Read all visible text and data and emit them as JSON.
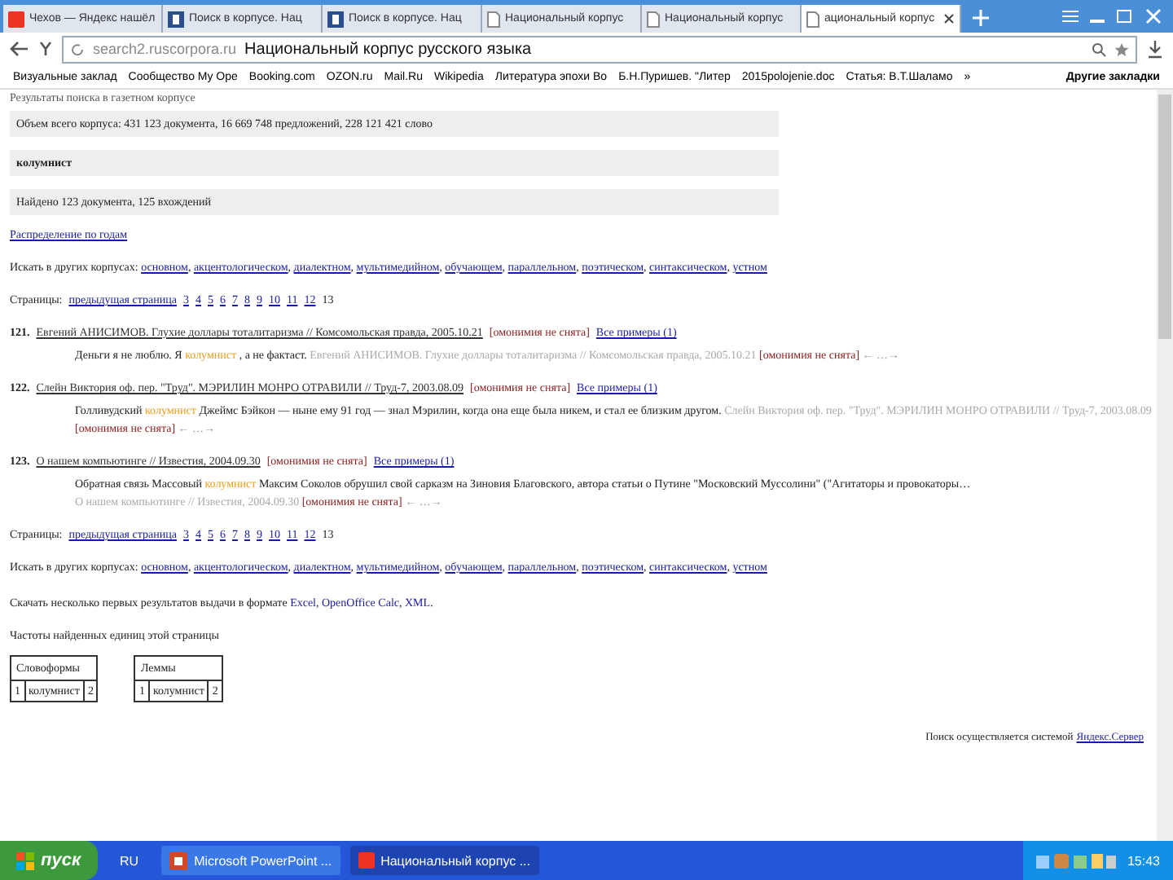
{
  "browser": {
    "tabs": [
      {
        "label": "Чехов — Яндекс нашёл",
        "selected": false
      },
      {
        "label": "Поиск в корпусе. Нац",
        "selected": false
      },
      {
        "label": "Поиск в корпусе. Нац",
        "selected": false
      },
      {
        "label": "Национальный корпус",
        "selected": false
      },
      {
        "label": "Национальный корпус",
        "selected": false
      },
      {
        "label": "ациональный корпус",
        "selected": true
      }
    ],
    "address": {
      "url": "search2.ruscorpora.ru",
      "title": "Национальный корпус русского языка"
    },
    "bookmarks": [
      "Визуальные заклад",
      "Сообщество My Ope",
      "Booking.com",
      "OZON.ru",
      "Mail.Ru",
      "Wikipedia",
      "Литература эпохи Во",
      "Б.Н.Пуришев. \"Литер",
      "2015polojenie.doc",
      "Статья: В.Т.Шаламо",
      "»"
    ],
    "other_bookmarks": "Другие закладки"
  },
  "page": {
    "heading": "Результаты поиска в газетном корпусе",
    "info_boxes": [
      {
        "text": "Объем всего корпуса: 431 123 документа, 16 669 748 предложений, 228 121 421 слово",
        "bold": false
      },
      {
        "text": "колумнист",
        "bold": true
      },
      {
        "text": "Найдено 123 документа, 125 вхождений",
        "bold": false
      }
    ],
    "distribution_link": "Распределение по годам",
    "other_corpora_top": {
      "label": "Искать в других корпусах:",
      "separator": ",",
      "links": [
        "основном",
        "акцентологическом",
        "диалектном",
        "мультимедийном",
        "обучающем",
        "параллельном",
        "поэтическом",
        "синтаксическом",
        "устном"
      ]
    },
    "pages_top": {
      "label": "Страницы:",
      "prev": "предыдущая страница",
      "pages": [
        {
          "n": "3",
          "selected": false
        },
        {
          "n": "4",
          "selected": false
        },
        {
          "n": "5",
          "selected": false
        },
        {
          "n": "6",
          "selected": false
        },
        {
          "n": "7",
          "selected": false
        },
        {
          "n": "8",
          "selected": false
        },
        {
          "n": "9",
          "selected": false
        },
        {
          "n": "10",
          "selected": false
        },
        {
          "n": "11",
          "selected": false
        },
        {
          "n": "12",
          "selected": false
        },
        {
          "n": "13",
          "selected": true
        }
      ]
    },
    "results": [
      {
        "number": "121.",
        "title": "Евгений АНИСИМОВ. Глухие доллары тоталитаризма // Комсомольская правда, 2005.10.21",
        "tag": "[омонимия не снята]",
        "all_link": "Все примеры (1)",
        "snippet": [
          {
            "kind": "text",
            "text": "Деньги я не люблю. Я"
          },
          {
            "kind": "hit",
            "text": "колумнист"
          },
          {
            "kind": "text",
            "text": ", а не фактаст."
          },
          {
            "kind": "source",
            "text": "Евгений АНИСИМОВ. Глухие доллары тоталитаризма // Комсомольская правда, 2005.10.21"
          },
          {
            "kind": "tag",
            "text": "[омонимия не снята]"
          },
          {
            "kind": "nav",
            "text": "← …→"
          }
        ]
      },
      {
        "number": "122.",
        "title": "Слейн Виктория оф. пер. \"Труд\". МЭРИЛИН МОНРО ОТРАВИЛИ // Труд-7, 2003.08.09",
        "tag": "[омонимия не снята]",
        "all_link": "Все примеры (1)",
        "snippet": [
          {
            "kind": "text",
            "text": "Голливудский"
          },
          {
            "kind": "hit",
            "text": "колумнист"
          },
          {
            "kind": "text",
            "text": "Джеймс Бэйкон — ныне ему 91 год — знал Мэрилин, когда она еще была никем, и стал ее близким другом."
          },
          {
            "kind": "source",
            "text": "Слейн Виктория оф. пер. \"Труд\". МЭРИЛИН МОНРО ОТРАВИЛИ // Труд-7, 2003.08.09"
          },
          {
            "kind": "tag",
            "text": "[омонимия не снята]"
          },
          {
            "kind": "nav",
            "text": "← …→"
          }
        ]
      },
      {
        "number": "123.",
        "title": "О нашем компьютинге // Известия, 2004.09.30",
        "tag": "[омонимия не снята]",
        "all_link": "Все примеры (1)",
        "snippet": [
          {
            "kind": "text",
            "text": "Обратная связь Массовый"
          },
          {
            "kind": "hit",
            "text": "колумнист"
          },
          {
            "kind": "text",
            "text": "Максим Соколов обрушил свой сарказм на Зиновия Благовского, автора статьи о Путине \"Московский Муссолини\" (\"Агитаторы и провокаторы…"
          },
          {
            "kind": "source",
            "text": "О нашем компьютинге // Известия, 2004.09.30"
          },
          {
            "kind": "tag",
            "text": "[омонимия не снята]"
          },
          {
            "kind": "nav",
            "text": "← …→"
          }
        ]
      }
    ],
    "pages_bottom": {
      "label": "Страницы:",
      "prev": "предыдущая страница",
      "pages": [
        {
          "n": "3",
          "selected": false
        },
        {
          "n": "4",
          "selected": false
        },
        {
          "n": "5",
          "selected": false
        },
        {
          "n": "6",
          "selected": false
        },
        {
          "n": "7",
          "selected": false
        },
        {
          "n": "8",
          "selected": false
        },
        {
          "n": "9",
          "selected": false
        },
        {
          "n": "10",
          "selected": false
        },
        {
          "n": "11",
          "selected": false
        },
        {
          "n": "12",
          "selected": false
        },
        {
          "n": "13",
          "selected": true
        }
      ]
    },
    "other_corpora_bottom": {
      "label": "Искать в других корпусах:",
      "separator": ",",
      "links": [
        "основном",
        "акцентологическом",
        "диалектном",
        "мультимедийном",
        "обучающем",
        "параллельном",
        "поэтическом",
        "синтаксическом",
        "устном"
      ]
    },
    "download": {
      "text": "Скачать несколько первых результатов выдачи в формате",
      "separator": ",",
      "end": ".",
      "links": [
        "Excel",
        "OpenOffice Calc",
        "XML"
      ]
    },
    "freq_heading": "Частоты найденных единиц этой страницы",
    "freq_tables": [
      {
        "title": "Словоформы",
        "rows": [
          [
            "1",
            "колумнист",
            "2"
          ]
        ]
      },
      {
        "title": "Леммы",
        "rows": [
          [
            "1",
            "колумнист",
            "2"
          ]
        ]
      }
    ],
    "footer": {
      "text": "Поиск осуществляется системой",
      "link": "Яндекс.Сервер"
    }
  },
  "taskbar": {
    "start": "пуск",
    "lang": "RU",
    "tasks": [
      {
        "label": "Microsoft PowerPoint ...",
        "selected": false
      },
      {
        "label": "Национальный корпус ...",
        "selected": true
      }
    ],
    "clock": "15:43"
  }
}
